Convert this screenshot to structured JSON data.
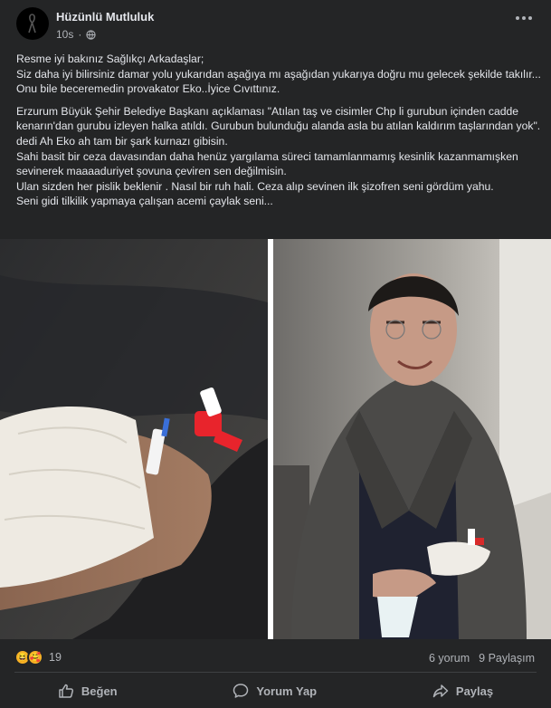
{
  "post": {
    "author": "Hüzünlü Mutluluk",
    "time": "10s",
    "icons": {
      "avatar": "black-ribbon",
      "privacy": "globe-icon",
      "menu": "more-dots-icon"
    },
    "paragraphs": [
      "Resme iyi bakınız Sağlıkçı Arkadaşlar;\nSiz daha iyi bilirsiniz damar yolu yukarıdan aşağıya mı aşağıdan yukarıya doğru mu gelecek şekilde takılır...\nOnu bile beceremedin provakator Eko..İyice Cıvıttınız.",
      "Erzurum Büyük Şehir Belediye Başkanı açıklaması \"Atılan taş ve cisimler Chp li gurubun içinden cadde kenarın'dan gurubu izleyen halka atıldı. Gurubun bulunduğu alanda asla bu atılan kaldırım taşlarından yok\". dedi  Ah Eko ah tam bir şark kurnazı gibisin.\nSahi basit bir ceza davasından daha henüz yargılama süreci tamamlanmamış kesinlik kazanmamışken sevinerek maaaaduriyet şovuna çeviren sen değilmisin.\nUlan sizden her pislik beklenir . Nasıl bir ruh hali. Ceza alıp sevinen ilk şizofren seni gördüm yahu.\nSeni gidi tilkilik yapmaya çalışan acemi çaylak seni..."
    ]
  },
  "stats": {
    "reaction_count": "19",
    "comments": "6 yorum",
    "shares": "9 Paylaşım",
    "reaction_icons": [
      "haha-emoji",
      "care-emoji"
    ]
  },
  "actions": {
    "like": "Beğen",
    "comment": "Yorum Yap",
    "share": "Paylaş"
  },
  "colors": {
    "background": "#242526",
    "text": "#e4e6eb",
    "muted": "#b0b3b8",
    "divider": "#3e4042"
  }
}
